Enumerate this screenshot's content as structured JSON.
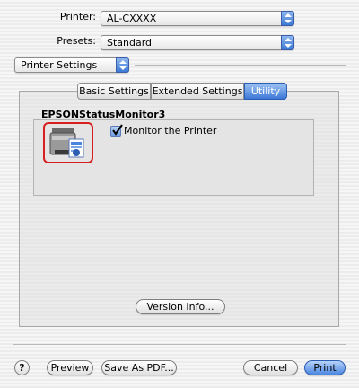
{
  "printer": {
    "label": "Printer:",
    "value": "AL-CXXXX"
  },
  "presets": {
    "label": "Presets:",
    "value": "Standard"
  },
  "section_popup": {
    "value": "Printer Settings"
  },
  "tabs": [
    {
      "label": "Basic Settings"
    },
    {
      "label": "Extended Settings"
    },
    {
      "label": "Utility"
    }
  ],
  "active_tab": "Utility",
  "utility": {
    "group_title": "EPSONStatusMonitor3",
    "monitor_checkbox": {
      "label": "Monitor the Printer",
      "checked": true
    },
    "version_button": "Version Info..."
  },
  "footer": {
    "help": "?",
    "preview": "Preview",
    "save_as_pdf": "Save As PDF...",
    "cancel": "Cancel",
    "print": "Print"
  },
  "colors": {
    "accent": "#3d7ad6",
    "highlight_border": "#d81e1e"
  },
  "icons": {
    "app_icon": "printer-monitor-icon"
  }
}
